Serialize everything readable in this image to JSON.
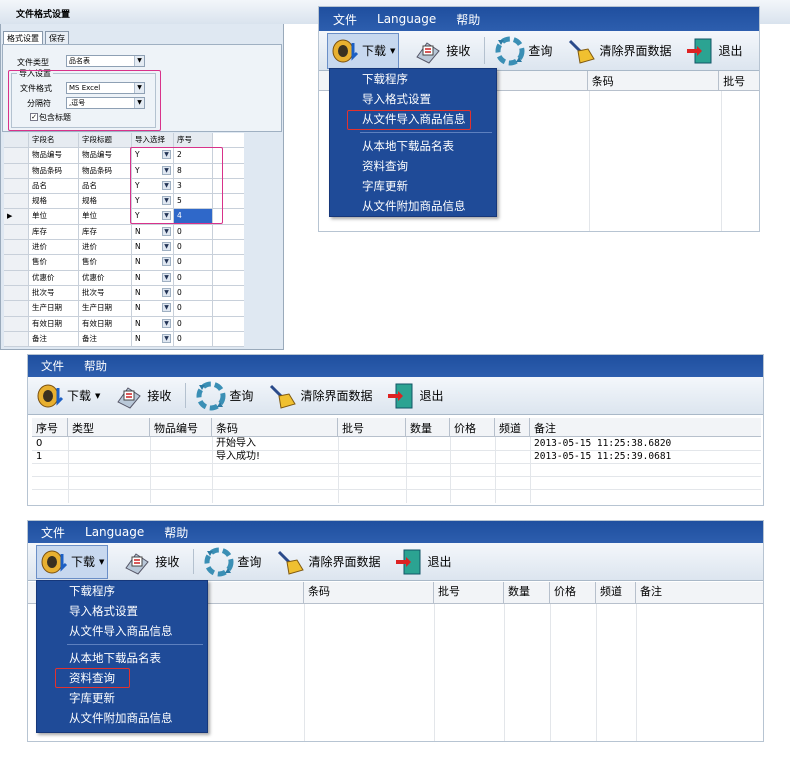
{
  "panel1": {
    "title": "文件格式设置",
    "tabs": [
      "格式设置",
      "保存"
    ],
    "file_type_label": "文件类型",
    "file_type_value": "品名表",
    "import_group_title": "导入设置",
    "file_format_label": "文件格式",
    "file_format_value": "MS Excel",
    "separator_label": "分隔符",
    "separator_value": ",逗号",
    "include_header_label": "包含标题",
    "include_header_checked": true,
    "grid_headers": [
      "字段名",
      "字段标题",
      "导入选择",
      "序号"
    ],
    "grid_rows": [
      {
        "name": "物品编号",
        "title": "物品编号",
        "select": "Y",
        "seq": "2"
      },
      {
        "name": "物品条码",
        "title": "物品条码",
        "select": "Y",
        "seq": "8"
      },
      {
        "name": "品名",
        "title": "品名",
        "select": "Y",
        "seq": "3"
      },
      {
        "name": "规格",
        "title": "规格",
        "select": "Y",
        "seq": "5"
      },
      {
        "name": "单位",
        "title": "单位",
        "select": "Y",
        "seq": "4"
      },
      {
        "name": "库存",
        "title": "库存",
        "select": "N",
        "seq": "0"
      },
      {
        "name": "进价",
        "title": "进价",
        "select": "N",
        "seq": "0"
      },
      {
        "name": "售价",
        "title": "售价",
        "select": "N",
        "seq": "0"
      },
      {
        "name": "优惠价",
        "title": "优惠价",
        "select": "N",
        "seq": "0"
      },
      {
        "name": "批次号",
        "title": "批次号",
        "select": "N",
        "seq": "0"
      },
      {
        "name": "生产日期",
        "title": "生产日期",
        "select": "N",
        "seq": "0"
      },
      {
        "name": "有效日期",
        "title": "有效日期",
        "select": "N",
        "seq": "0"
      },
      {
        "name": "备注",
        "title": "备注",
        "select": "N",
        "seq": "0"
      }
    ]
  },
  "menubar": {
    "file": "文件",
    "language": "Language",
    "help": "帮助"
  },
  "toolbar": {
    "download": "下载",
    "receive": "接收",
    "query": "查询",
    "clear": "清除界面数据",
    "exit": "退出"
  },
  "download_menu": {
    "items": [
      "下载程序",
      "导入格式设置",
      "从文件导入商品信息",
      "从本地下载品名表",
      "资料查询",
      "字库更新",
      "从文件附加商品信息"
    ]
  },
  "panel2": {
    "columns": [
      "条码",
      "批号"
    ]
  },
  "panel3": {
    "columns": [
      "序号",
      "类型",
      "物品编号",
      "条码",
      "批号",
      "数量",
      "价格",
      "频道",
      "备注"
    ],
    "rows": [
      {
        "seq": "0",
        "barcode": "开始导入",
        "note": "2013-05-15 11:25:38.6820"
      },
      {
        "seq": "1",
        "barcode": "导入成功!",
        "note": "2013-05-15 11:25:39.0681"
      }
    ]
  },
  "panel4": {
    "columns": [
      "条码",
      "批号",
      "数量",
      "价格",
      "频道",
      "备注"
    ]
  },
  "colors": {
    "menubar": "#2a5aa8",
    "dropdown": "#1f4b98",
    "highlight": "#e2322e",
    "pink_box": "#d8328a"
  }
}
